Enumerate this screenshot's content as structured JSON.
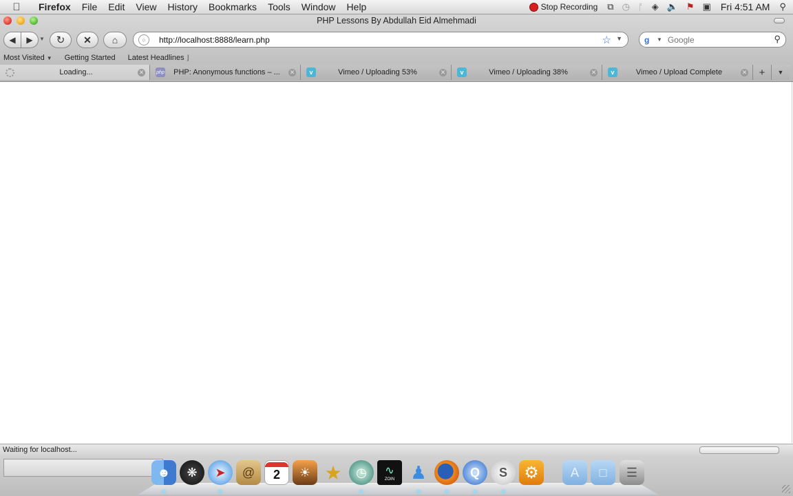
{
  "menubar": {
    "app": "Firefox",
    "menus": [
      "File",
      "Edit",
      "View",
      "History",
      "Bookmarks",
      "Tools",
      "Window",
      "Help"
    ],
    "stop_recording": "Stop Recording",
    "clock": "Fri 4:51 AM"
  },
  "window": {
    "title": "PHP Lessons By Abdullah Eid Almehmadi"
  },
  "navigation": {
    "url": "http://localhost:8888/learn.php"
  },
  "search": {
    "placeholder": "Google"
  },
  "bookmarks": {
    "most_visited": "Most Visited",
    "getting_started": "Getting Started",
    "latest_headlines": "Latest Headlines"
  },
  "tabs": [
    {
      "label": "Loading...",
      "icon": "spinner-icon",
      "selected": true
    },
    {
      "label": "PHP: Anonymous functions – ...",
      "icon": "php-icon",
      "selected": false
    },
    {
      "label": "Vimeo / Uploading 53%",
      "icon": "vimeo-icon",
      "selected": false
    },
    {
      "label": "Vimeo / Uploading 38%",
      "icon": "vimeo-icon",
      "selected": false
    },
    {
      "label": "Vimeo / Upload Complete",
      "icon": "vimeo-icon",
      "selected": false
    }
  ],
  "status": {
    "text": "Waiting for localhost..."
  },
  "colors": {
    "accent": "#3a6ec6",
    "vimeo": "#4bb6d6",
    "recording": "#d61f1f"
  },
  "dock": {
    "items": [
      "finder-icon",
      "dashboard-icon",
      "safari-icon",
      "address-book-icon",
      "ical-icon",
      "iphoto-icon",
      "imovie-icon",
      "time-machine-icon",
      "zoin-icon",
      "messenger-icon",
      "firefox-icon",
      "quicktime-icon",
      "skype-icon",
      "system-preferences-icon",
      "applications-folder-icon",
      "documents-folder-icon",
      "trash-icon"
    ],
    "ical_day": "2",
    "zoin_label": "ZOIN"
  }
}
